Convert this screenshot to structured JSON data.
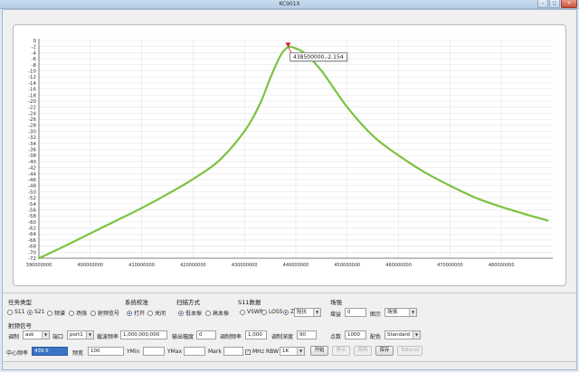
{
  "window": {
    "title": "KC901X",
    "minimize": "–",
    "maximize": "□",
    "close": "✕"
  },
  "colors": {
    "trace": "#7dc242",
    "marker": "#d81f1f",
    "grid": "#e4e4e4",
    "axis": "#555555"
  },
  "chart_data": {
    "type": "line",
    "title": "",
    "xlabel": "",
    "ylabel": "",
    "xlim": [
      390000000,
      490000000
    ],
    "ylim": [
      -72,
      0
    ],
    "y_ticks": [
      0,
      -2,
      -4,
      -6,
      -8,
      -10,
      -12,
      -14,
      -16,
      -18,
      -20,
      -22,
      -24,
      -26,
      -28,
      -30,
      -32,
      -34,
      -36,
      -38,
      -40,
      -42,
      -44,
      -46,
      -48,
      -50,
      -52,
      -54,
      -56,
      -58,
      -60,
      -62,
      -64,
      -66,
      -68,
      -70,
      -72
    ],
    "x_ticks": [
      390000000,
      400000000,
      410000000,
      420000000,
      430000000,
      440000000,
      450000000,
      460000000,
      470000000,
      480000000
    ],
    "grid": true,
    "series": [
      {
        "x": [
          390000000,
          395000000,
          400000000,
          405000000,
          410000000,
          415000000,
          420000000,
          425000000,
          430000000,
          433000000,
          435000000,
          437000000,
          438500000,
          440000000,
          442000000,
          445000000,
          450000000,
          455000000,
          460000000,
          465000000,
          470000000,
          475000000,
          480000000,
          485000000,
          489000000
        ],
        "y": [
          -72,
          -68,
          -63.8,
          -59.6,
          -55.4,
          -50.8,
          -45.8,
          -39.8,
          -30,
          -21,
          -12.5,
          -5,
          -2.154,
          -2.6,
          -4.5,
          -10,
          -22,
          -31.5,
          -38,
          -43.5,
          -48,
          -52,
          -55,
          -57.6,
          -59.5
        ]
      }
    ],
    "marker": {
      "x": 438500000,
      "y": -2.154,
      "label": "438500000,-2.154"
    }
  },
  "panel": {
    "task": {
      "title": "任务类型",
      "options": [
        {
          "label": "S11",
          "selected": false
        },
        {
          "label": "S21",
          "selected": true
        },
        {
          "label": "频谱",
          "selected": false
        },
        {
          "label": "场强",
          "selected": false
        },
        {
          "label": "射频信号",
          "selected": false
        }
      ]
    },
    "calibration": {
      "title": "系统校准",
      "options": [
        {
          "label": "打开",
          "selected": true
        },
        {
          "label": "关闭",
          "selected": false
        }
      ]
    },
    "scan": {
      "title": "扫描方式",
      "options": [
        {
          "label": "低本振",
          "selected": true
        },
        {
          "label": "高本振",
          "selected": false
        }
      ]
    },
    "s11": {
      "title": "S11数据",
      "options": [
        {
          "label": "VSWR",
          "selected": false
        },
        {
          "label": "LOSS",
          "selected": false
        },
        {
          "label": "Z",
          "selected": true
        }
      ],
      "combo": "阻抗"
    },
    "field": {
      "title": "场强",
      "gain_label": "增益",
      "gain_value": "0",
      "display_label": "图示",
      "display_value": "场强"
    },
    "rf": {
      "title": "射频信号",
      "mod_label": "调制",
      "mod_value": "ask",
      "port_label": "端口",
      "port_value": "port1",
      "carrier_label": "载波频率",
      "carrier_value": "1,000,000,000",
      "amp_label": "输出幅度",
      "amp_value": "0",
      "modfreq_label": "调制频率",
      "modfreq_value": "1,000",
      "depth_label": "调制深度",
      "depth_value": "90",
      "points_label": "点数",
      "points_value": "1000",
      "color_label": "配色",
      "color_value": "Standard"
    },
    "bottom": {
      "center_label": "中心频率",
      "center_value": "439.5",
      "span_label": "频宽",
      "span_value": "100",
      "ymin_label": "YMin",
      "ymin_value": "",
      "ymax_label": "YMax",
      "ymax_value": "",
      "mark_label": "Mark",
      "mark_value": "",
      "mhz_label": "MHz",
      "mhz_checked": true,
      "rbw_label": "RBW",
      "rbw_value": "1K",
      "start": "开始",
      "stop": "停止",
      "hold": "保持",
      "save": "保存",
      "excel": "ToExcel"
    }
  }
}
